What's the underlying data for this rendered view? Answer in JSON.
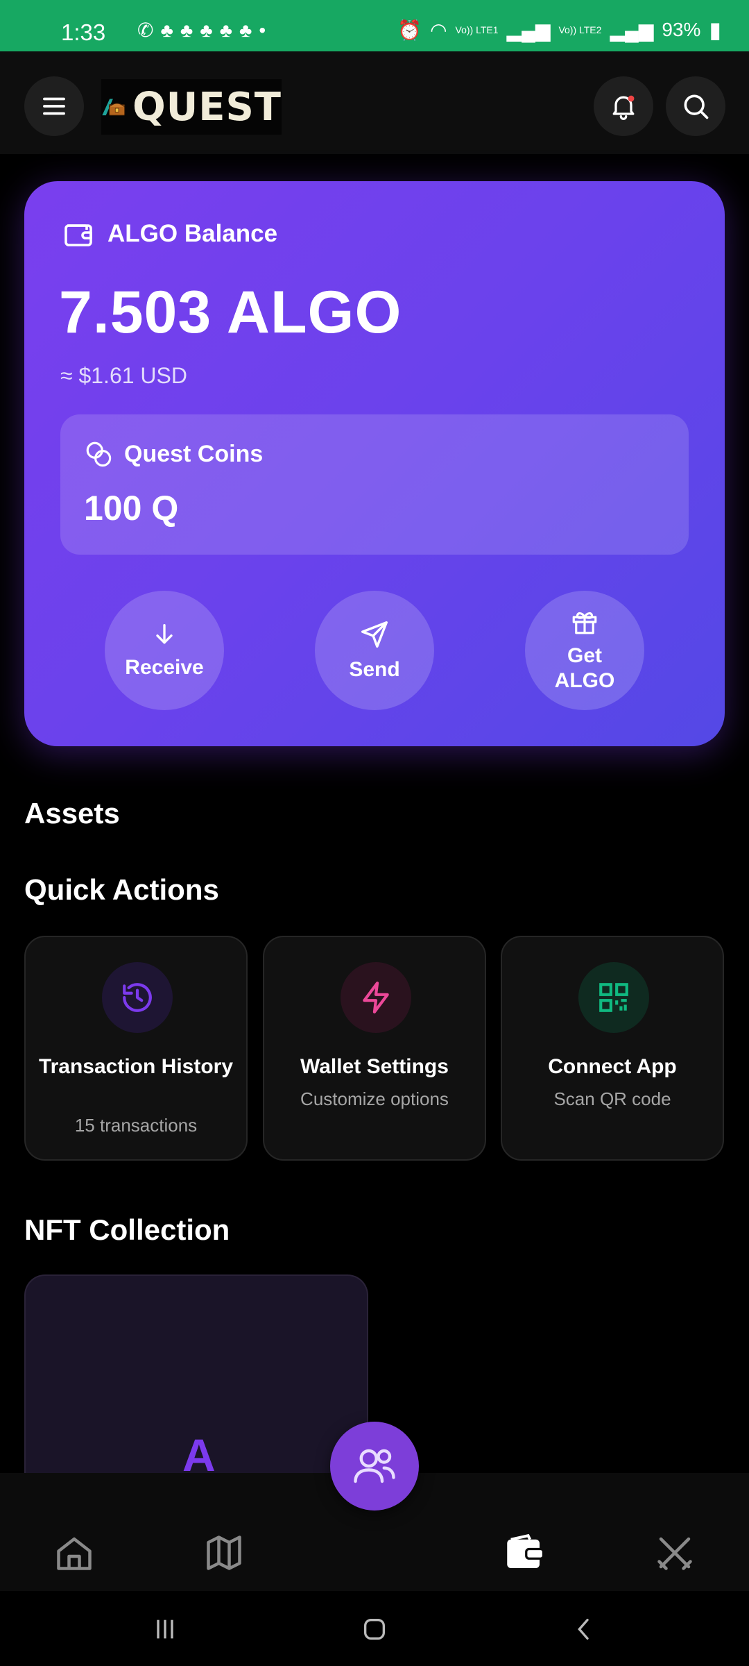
{
  "status_bar": {
    "time": "1:33",
    "battery": "93%",
    "net1": "Vo)) LTE1",
    "net2": "Vo)) LTE2"
  },
  "header": {
    "logo_text": "QUEST",
    "icons": [
      "menu-icon",
      "bell-icon",
      "search-icon"
    ]
  },
  "balance": {
    "title": "ALGO Balance",
    "amount": "7.503 ALGO",
    "usd": "≈ $1.61 USD",
    "coins_title": "Quest Coins",
    "coins_value": "100 Q",
    "actions": [
      {
        "label": "Receive",
        "icon": "arrow-down-icon"
      },
      {
        "label": "Send",
        "icon": "send-icon"
      },
      {
        "label": "Get ALGO",
        "icon": "gift-icon"
      }
    ]
  },
  "assets": {
    "title": "Assets"
  },
  "quick_actions": {
    "title": "Quick Actions",
    "items": [
      {
        "title": "Transaction History",
        "subtitle": "15 transactions",
        "icon": "history-icon",
        "color": "#7c3aed"
      },
      {
        "title": "Wallet Settings",
        "subtitle": "Customize options",
        "icon": "lightning-icon",
        "color": "#ec4899"
      },
      {
        "title": "Connect App",
        "subtitle": "Scan QR code",
        "icon": "qr-code-icon",
        "color": "#10b981"
      }
    ]
  },
  "nft": {
    "title": "NFT Collection",
    "card_letter": "A"
  },
  "bottom_nav": {
    "items": [
      "home-icon",
      "map-icon",
      "friends-icon",
      "wallet-icon",
      "battle-icon"
    ],
    "active": "wallet-icon"
  },
  "colors": {
    "status_bar": "#17a862",
    "card_start": "#7a3fee",
    "card_end": "#5448e6",
    "fab": "#7d3ed9"
  }
}
